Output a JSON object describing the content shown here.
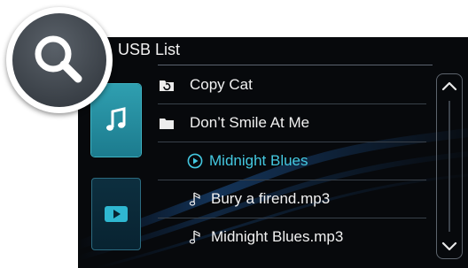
{
  "header": {
    "title": "USB List"
  },
  "sources": [
    {
      "name": "music-source",
      "icon": "music-note-icon",
      "selected": true
    },
    {
      "name": "video-source",
      "icon": "play-icon",
      "selected": false
    }
  ],
  "list": {
    "items": [
      {
        "label": "Copy Cat",
        "icon": "folder-up-icon"
      },
      {
        "label": "Don’t Smile At Me",
        "icon": "folder-icon"
      },
      {
        "label": "Midnight Blues",
        "icon": "playing-icon",
        "active": true
      },
      {
        "label": "Bury a firend.mp3",
        "icon": "music-note-icon"
      },
      {
        "label": "Midnight Blues.mp3",
        "icon": "music-note-icon"
      }
    ]
  },
  "colors": {
    "accent": "#44c8e0",
    "background": "#07090c",
    "source_selected": "#2f9fb0"
  }
}
